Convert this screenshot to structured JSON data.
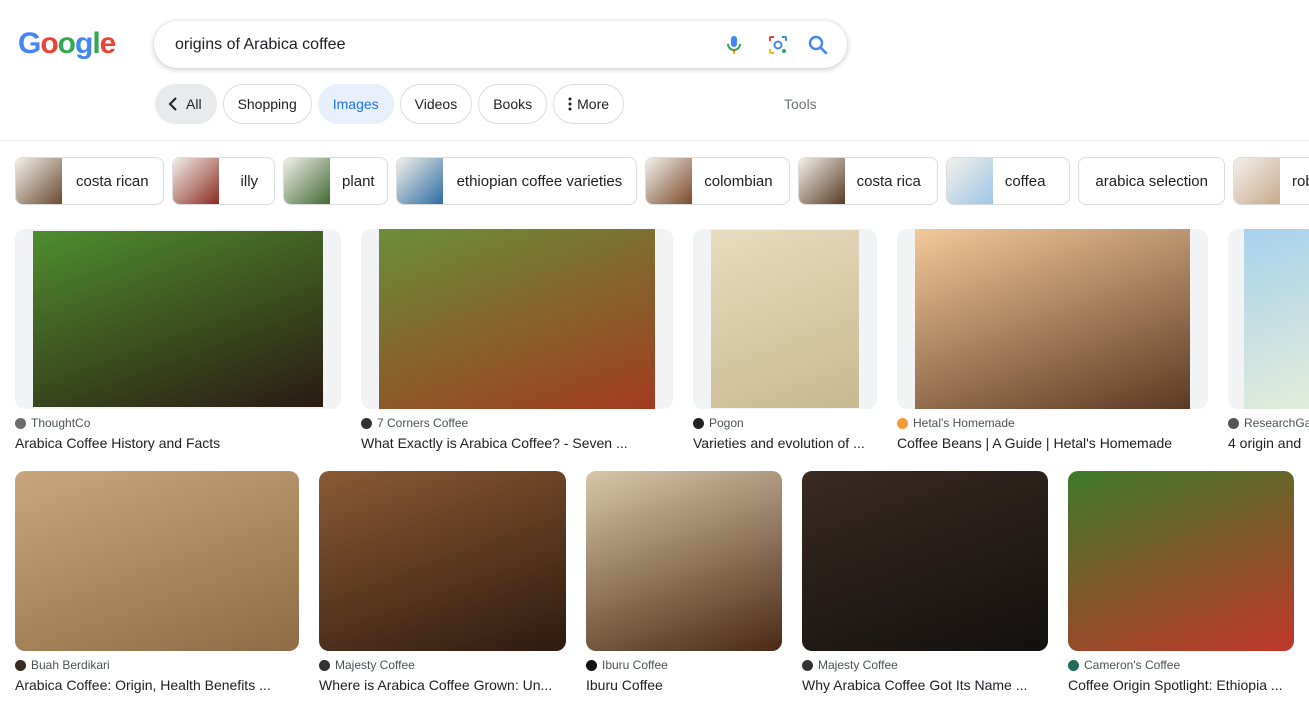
{
  "logo": {
    "letters": [
      "G",
      "o",
      "o",
      "g",
      "l",
      "e"
    ],
    "colors": [
      "#4285f4",
      "#ea4335",
      "#34a853",
      "#4285f4",
      "#34a853",
      "#ea4335"
    ]
  },
  "search": {
    "query": "origins of Arabica coffee",
    "icons": [
      "microphone-icon",
      "lens-icon",
      "search-icon"
    ]
  },
  "tabs": [
    {
      "label": "All",
      "kind": "back"
    },
    {
      "label": "Shopping"
    },
    {
      "label": "Images",
      "kind": "active"
    },
    {
      "label": "Videos"
    },
    {
      "label": "Books"
    },
    {
      "label": "More",
      "kind": "more"
    }
  ],
  "tools_label": "Tools",
  "chips": [
    {
      "label": "costa rican",
      "color": "#6b4a2f"
    },
    {
      "label": "illy",
      "color": "#8b2b1f"
    },
    {
      "label": "plant",
      "color": "#3f6b32"
    },
    {
      "label": "ethiopian coffee varieties",
      "color": "#2d6ca2"
    },
    {
      "label": "colombian",
      "color": "#7a4b2a"
    },
    {
      "label": "costa rica",
      "color": "#5a3b22"
    },
    {
      "label": "coffea",
      "color": "#9cc7e6"
    },
    {
      "label": "arabica selection",
      "color": ""
    },
    {
      "label": "robu",
      "color": "#c9a98a"
    }
  ],
  "results": [
    {
      "source": "ThoughtCo",
      "title": "Arabica Coffee History and Facts",
      "fav": "#6b6b6b",
      "colors": [
        "#4f8d2f",
        "#2a1a12"
      ]
    },
    {
      "source": "7 Corners Coffee",
      "title": "What Exactly is Arabica Coffee? - Seven ...",
      "fav": "#333333",
      "colors": [
        "#6a8e3a",
        "#a23a1f"
      ]
    },
    {
      "source": "Pogon",
      "title": "Varieties and evolution of ...",
      "fav": "#222222",
      "colors": [
        "#e8dcc0",
        "#c9b890"
      ]
    },
    {
      "source": "Hetal's Homemade",
      "title": "Coffee Beans | A Guide | Hetal's Homemade",
      "fav": "#f29b38",
      "colors": [
        "#f2c99a",
        "#5b3a24"
      ]
    },
    {
      "source": "ResearchGa",
      "title": "4 origin and",
      "fav": "#555555",
      "colors": [
        "#a9d1ec",
        "#e6efd9"
      ]
    },
    {
      "source": "Buah Berdikari",
      "title": "Arabica Coffee: Origin, Health Benefits ...",
      "fav": "#3a2a22",
      "colors": [
        "#c9a77e",
        "#8d6b44"
      ]
    },
    {
      "source": "Majesty Coffee",
      "title": "Where is Arabica Coffee Grown: Un...",
      "fav": "#333333",
      "colors": [
        "#8a5a35",
        "#2e1a0e"
      ]
    },
    {
      "source": "Iburu Coffee",
      "title": "Iburu Coffee",
      "fav": "#111111",
      "colors": [
        "#d9c7a8",
        "#4a2a16"
      ]
    },
    {
      "source": "Majesty Coffee",
      "title": "Why Arabica Coffee Got Its Name ...",
      "fav": "#333333",
      "colors": [
        "#3a2a22",
        "#12100e"
      ]
    },
    {
      "source": "Cameron's Coffee",
      "title": "Coffee Origin Spotlight: Ethiopia ...",
      "fav": "#1f6b5c",
      "colors": [
        "#3e7a2a",
        "#c0362a"
      ]
    }
  ]
}
